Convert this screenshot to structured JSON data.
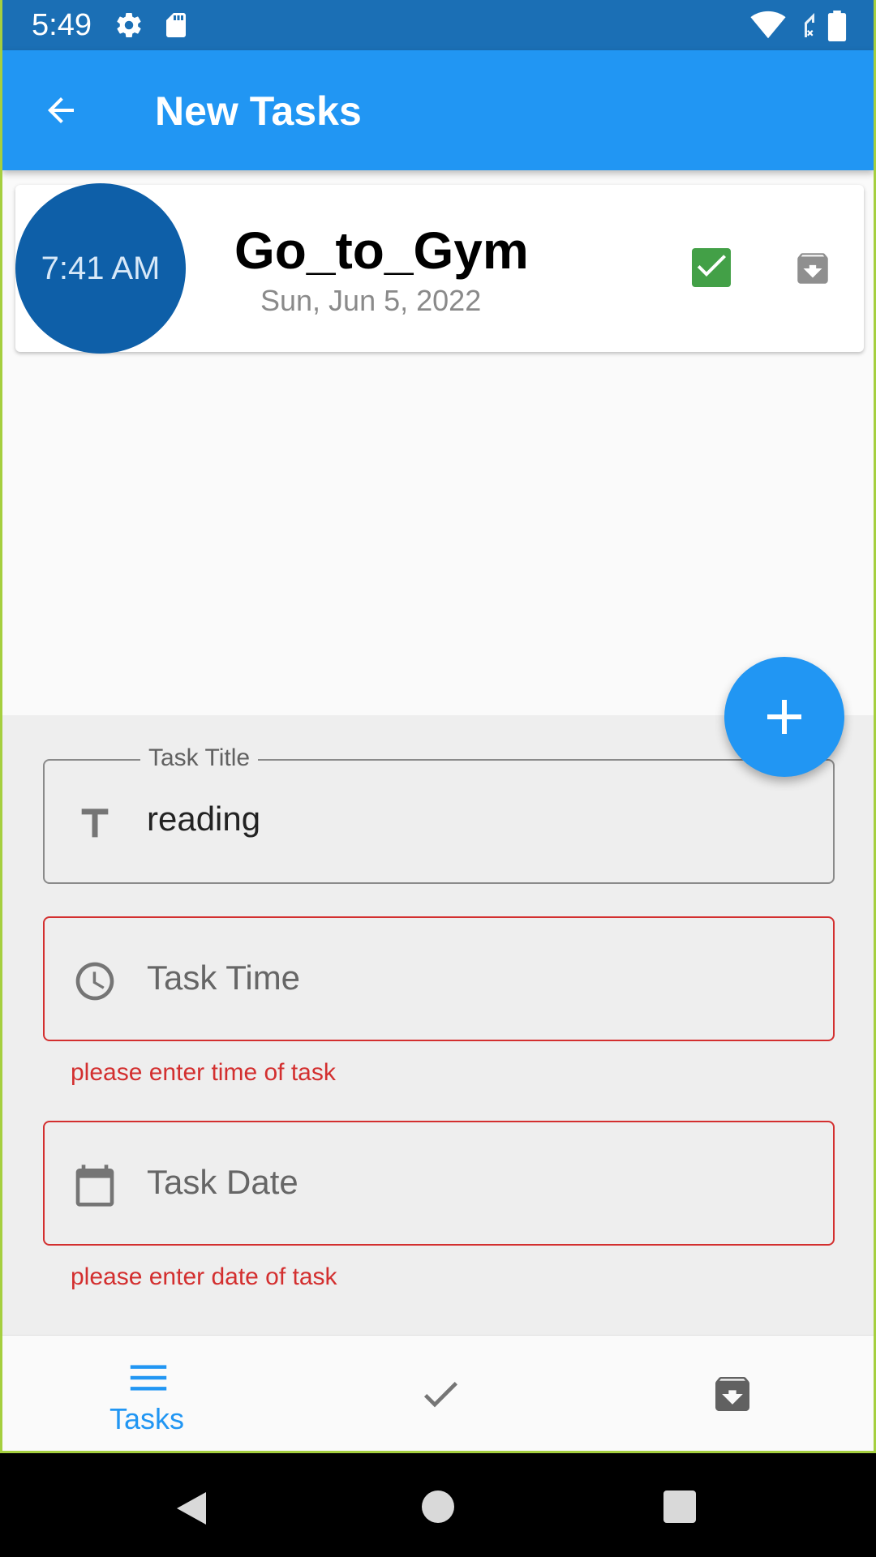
{
  "status_bar": {
    "time": "5:49"
  },
  "app_bar": {
    "title": "New Tasks"
  },
  "task": {
    "time": "7:41 AM",
    "title": "Go_to_Gym",
    "date": "Sun, Jun 5, 2022"
  },
  "form": {
    "title_label": "Task Title",
    "title_value": "reading",
    "time_placeholder": "Task Time",
    "time_error": "please enter time of task",
    "date_placeholder": "Task Date",
    "date_error": "please enter date of task"
  },
  "bottom_nav": {
    "items": [
      {
        "label": "Tasks",
        "icon": "menu-icon",
        "active": true
      },
      {
        "label": "",
        "icon": "check-icon",
        "active": false
      },
      {
        "label": "",
        "icon": "archive-icon",
        "active": false
      }
    ]
  },
  "colors": {
    "primary": "#2196f3",
    "status_bar": "#1b6fb5",
    "time_circle": "#0e5fa8",
    "error": "#d32f2f",
    "done_green": "#43a047"
  }
}
